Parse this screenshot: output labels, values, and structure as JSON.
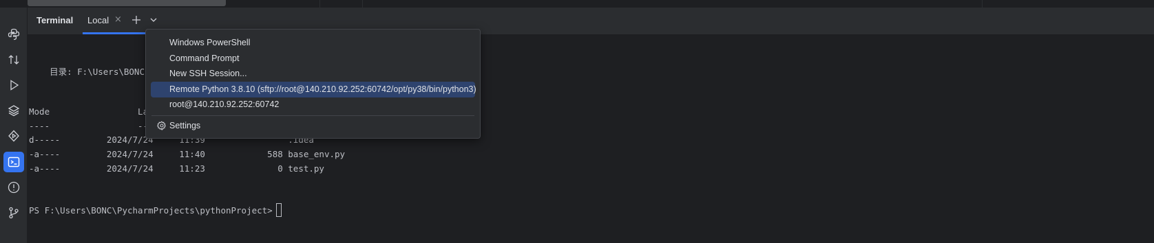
{
  "terminal": {
    "title": "Terminal",
    "tab_label": "Local",
    "close_glyph": "×"
  },
  "toolbar": {
    "add_icon": "plus-icon",
    "dropdown_icon": "chevron-down-icon"
  },
  "sidebar": {
    "icons": [
      "python-icon",
      "vcs-update-icon",
      "run-icon",
      "layers-icon",
      "services-icon",
      "terminal-icon",
      "problems-icon",
      "git-branch-icon"
    ],
    "active": "terminal-icon"
  },
  "colors": {
    "accent": "#3574f0",
    "selection": "#2e436e",
    "background": "#1e1f22",
    "panel": "#2b2d30"
  },
  "output": {
    "dir_line": "    目录: F:\\Users\\BONC",
    "header_line": "Mode                 La",
    "dash_line": "----                 --",
    "rows": [
      "d-----         2024/7/24     11:39                .idea",
      "-a----         2024/7/24     11:40            588 base_env.py",
      "-a----         2024/7/24     11:23              0 test.py"
    ],
    "prompt": "PS F:\\Users\\BONC\\PycharmProjects\\pythonProject> "
  },
  "menu": {
    "items": [
      "Windows PowerShell",
      "Command Prompt",
      "New SSH Session...",
      "Remote Python 3.8.10 (sftp://root@140.210.92.252:60742/opt/py38/bin/python3)",
      "root@140.210.92.252:60742"
    ],
    "selected_index": 3,
    "settings_label": "Settings"
  }
}
